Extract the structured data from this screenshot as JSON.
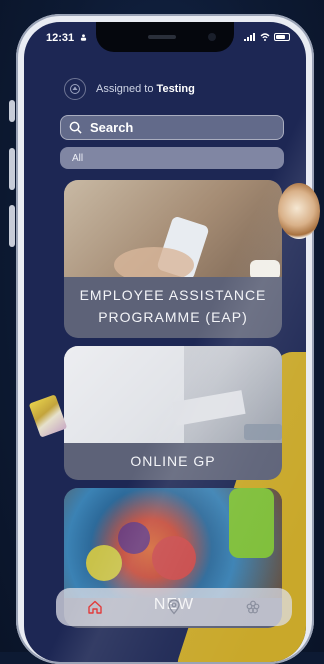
{
  "status_bar": {
    "time": "12:31"
  },
  "header": {
    "assigned_prefix": "Assigned to",
    "assigned_name": "Testing"
  },
  "search": {
    "label": "Search"
  },
  "filter": {
    "selected": "All"
  },
  "cards": [
    {
      "label": "EMPLOYEE ASSISTANCE PROGRAMME (EAP)"
    },
    {
      "label": "ONLINE GP"
    },
    {
      "label": ""
    }
  ],
  "bottom_nav": {
    "overlay_text": "NEW",
    "items": [
      {
        "icon": "home-icon",
        "active": true
      },
      {
        "icon": "location-pin-icon",
        "active": false
      },
      {
        "icon": "flower-icon",
        "active": false
      }
    ],
    "active_color": "#e23b3b"
  }
}
